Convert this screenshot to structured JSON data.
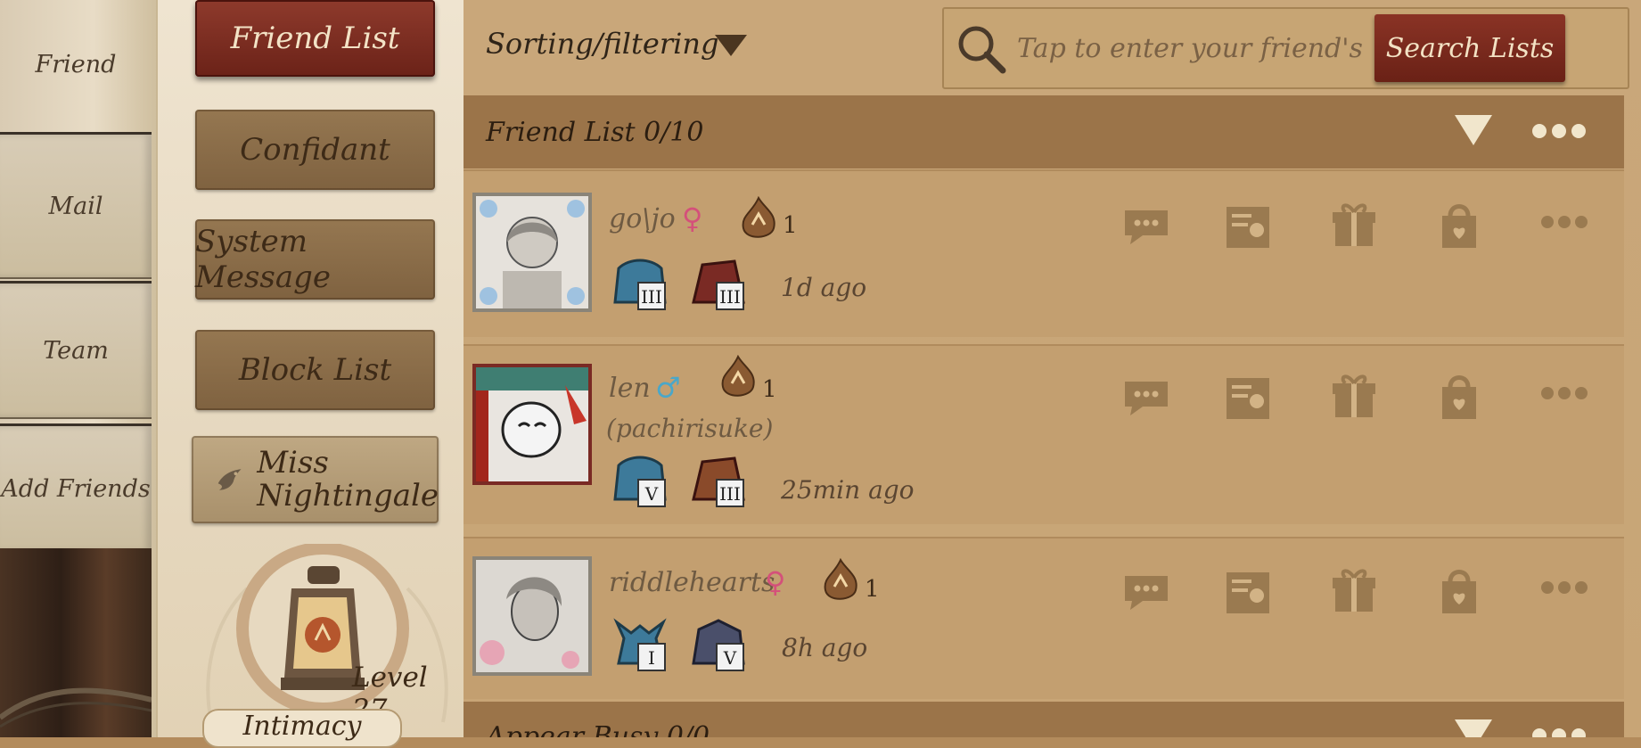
{
  "side_tabs": {
    "items": [
      {
        "label": "Friend",
        "active": true
      },
      {
        "label": "Mail",
        "active": false
      },
      {
        "label": "Team",
        "active": false
      },
      {
        "label": "Add Friends",
        "active": false
      }
    ]
  },
  "categories": {
    "items": [
      {
        "label": "Friend List",
        "active": true
      },
      {
        "label": "Confidant",
        "active": false
      },
      {
        "label": "System Message",
        "active": false
      },
      {
        "label": "Block List",
        "active": false
      }
    ],
    "special": {
      "line1": "Miss",
      "line2": "Nightingale"
    },
    "level_label": "Level 27",
    "intimacy_label": "Intimacy"
  },
  "toolbar": {
    "sort_label": "Sorting/filtering",
    "search_placeholder": "Tap to enter your friend's nickna",
    "search_button": "Search Lists"
  },
  "sections": {
    "friend_list": {
      "title": "Friend List 0/10"
    },
    "appear_busy": {
      "title": "Appear Busy 0/0"
    }
  },
  "friends": [
    {
      "nickname": "go\\jo",
      "gender": "♀",
      "gender_color": "#d4507a",
      "intimacy": "1",
      "remark": "",
      "time": "1d ago",
      "badges": [
        "III",
        "III"
      ]
    },
    {
      "nickname": "len",
      "gender": "♂",
      "gender_color": "#4aa7c9",
      "intimacy": "1",
      "remark": "(pachirisuke)",
      "time": "25min ago",
      "badges": [
        "V",
        "III"
      ]
    },
    {
      "nickname": "riddlehearts",
      "gender": "♀",
      "gender_color": "#d4507a",
      "intimacy": "1",
      "remark": "",
      "time": "8h ago",
      "badges": [
        "I",
        "V"
      ]
    }
  ],
  "colors": {
    "accent_red": "#7a2a1e",
    "panel": "#c39f70",
    "header": "#9b7449"
  }
}
